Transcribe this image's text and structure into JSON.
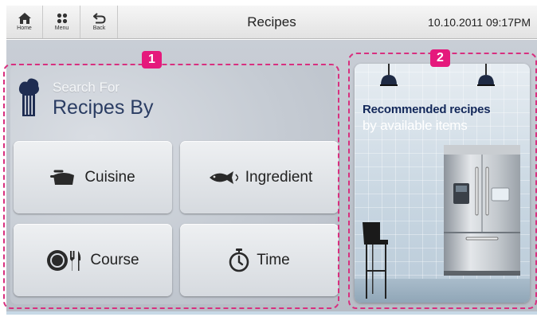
{
  "topbar": {
    "home_label": "Home",
    "menu_label": "Menu",
    "back_label": "Back",
    "title": "Recipes",
    "datetime": "10.10.2011 09:17PM"
  },
  "search": {
    "subtitle": "Search For",
    "title": "Recipes By",
    "buttons": [
      {
        "label": "Cuisine",
        "icon": "pot-icon"
      },
      {
        "label": "Ingredient",
        "icon": "fish-icon"
      },
      {
        "label": "Course",
        "icon": "plate-fork-icon"
      },
      {
        "label": "Time",
        "icon": "stopwatch-icon"
      }
    ]
  },
  "recommend": {
    "line1": "Recommended recipes",
    "line2": "by available items"
  },
  "annotations": {
    "badge1": "1",
    "badge2": "2"
  },
  "colors": {
    "accent_pink": "#e5197c",
    "title_navy": "#2b3d63"
  }
}
